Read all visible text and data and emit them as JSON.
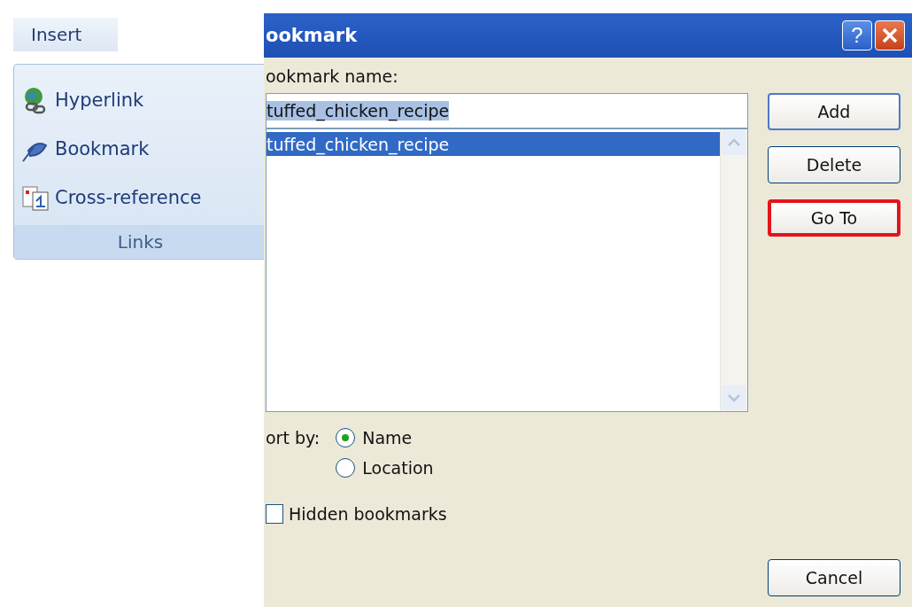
{
  "ribbon": {
    "tab": {
      "label": "Insert",
      "selected": true
    },
    "group": {
      "title": "Links",
      "items": [
        {
          "kind": "hyperlink",
          "label": "Hyperlink"
        },
        {
          "kind": "bookmark",
          "label": "Bookmark"
        },
        {
          "kind": "cross_reference",
          "label": "Cross-reference"
        }
      ]
    }
  },
  "dialog": {
    "title": "ookmark",
    "title_buttons": [
      {
        "kind": "help",
        "label": "?"
      },
      {
        "kind": "close"
      }
    ],
    "name_label": "ookmark name:",
    "name_field": {
      "value": "tuffed_chicken_recipe"
    },
    "list": [
      {
        "label": "tuffed_chicken_recipe",
        "selected": true
      }
    ],
    "buttons": [
      {
        "label": "Add",
        "focused": true,
        "highlighted": false
      },
      {
        "label": "Delete",
        "focused": false,
        "highlighted": false
      },
      {
        "label": "Go To",
        "focused": false,
        "highlighted": true
      }
    ],
    "sort_label": "ort by:",
    "sort_options": [
      {
        "label": "Name",
        "selected": true
      },
      {
        "label": "Location",
        "selected": false
      }
    ],
    "hidden_checkbox": {
      "label": "Hidden bookmarks",
      "checked": false
    },
    "cancel": {
      "label": "Cancel"
    }
  }
}
